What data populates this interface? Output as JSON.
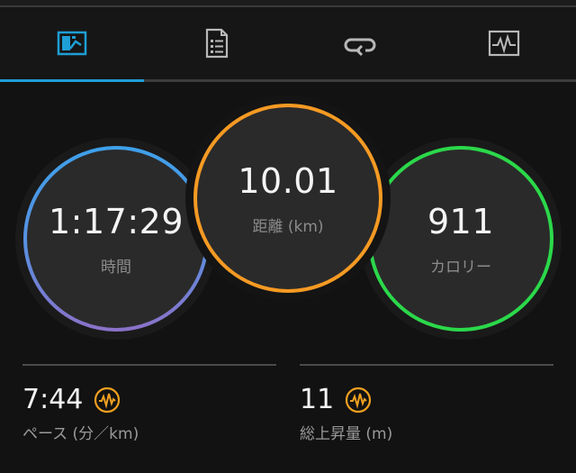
{
  "tabs": [
    {
      "icon": "overview-chart-icon",
      "active": true
    },
    {
      "icon": "details-list-icon",
      "active": false
    },
    {
      "icon": "laps-loop-icon",
      "active": false
    },
    {
      "icon": "heart-rate-graph-icon",
      "active": false
    }
  ],
  "colors": {
    "accent": "#1e9fd6",
    "time_ring": "#4a9fe6",
    "distance_ring": "#f59a23",
    "calories_ring": "#2bd84a",
    "wave_icon": "#f0a020"
  },
  "circles": {
    "time": {
      "value": "1:17:29",
      "label": "時間"
    },
    "distance": {
      "value": "10.01",
      "label": "距離 (km)"
    },
    "calories": {
      "value": "911",
      "label": "カロリー"
    }
  },
  "stats": {
    "pace": {
      "value": "7:44",
      "label": "ペース (分／km)",
      "icon": "waveform-icon"
    },
    "elevation": {
      "value": "11",
      "label": "総上昇量 (m)",
      "icon": "waveform-icon"
    }
  }
}
